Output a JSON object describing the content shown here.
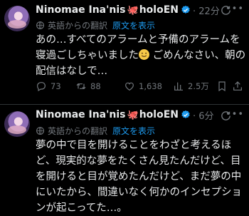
{
  "tweets": [
    {
      "name": "Ninomae Ina'nis",
      "octopus": "🐙",
      "handle_suffix": "holoEN",
      "time": "· 22分",
      "translation_label": "英語からの翻訳",
      "show_original": "原文を表示",
      "text_before_emoji": "あの…すべてのアラームと予備のアラームを寝過ごしちゃいました",
      "emoji": "slightly-smiling-face",
      "text_after_emoji": " ごめんなさい、朝の配信はなしで…",
      "stats": {
        "replies": "73",
        "reposts": "88",
        "likes": "1,638",
        "views": "2.5万"
      }
    },
    {
      "name": "Ninomae Ina'nis",
      "octopus": "🐙",
      "handle_suffix": "holoEN",
      "time": "· 6分",
      "translation_label": "英語からの翻訳",
      "show_original": "原文を表示",
      "text": "夢の中で目を開けることをわざと考えるほど、現実的な夢をたくさん見たんだけど、目を開けると目が覚めたんだけど、まだ夢の中にいたから、間違いなく何かのインセプションが起こってた…。"
    }
  ],
  "colors": {
    "accent": "#1d9bf0",
    "muted": "#71767b",
    "text": "#e7e9ea",
    "background": "#000000"
  },
  "icons": [
    "verified-badge-icon",
    "refresh-icon",
    "more-icon",
    "globe-icon",
    "reply-icon",
    "repost-icon",
    "like-icon",
    "views-icon",
    "bookmark-icon",
    "share-icon"
  ]
}
